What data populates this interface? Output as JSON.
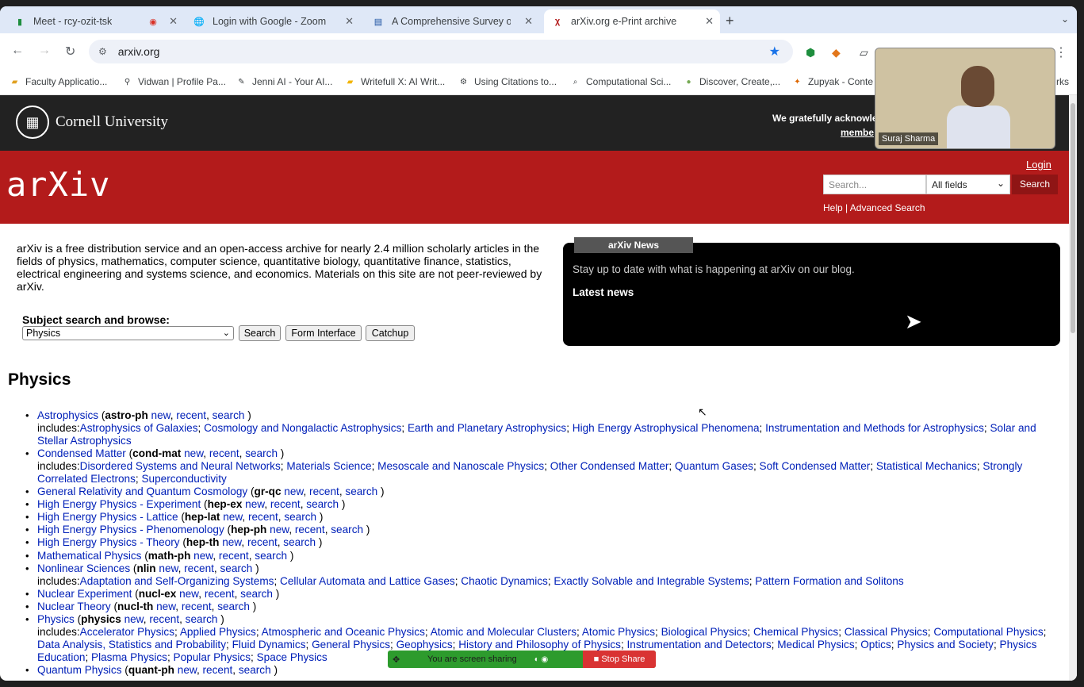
{
  "browser": {
    "tabs": [
      {
        "title": "Meet - rcy-ozit-tsk",
        "icon": "meet-icon"
      },
      {
        "title": "",
        "icon": "recording-icon"
      },
      {
        "title": "Login with Google - Zoom",
        "icon": "globe-icon"
      },
      {
        "title": "A Comprehensive Survey on",
        "icon": "doc-icon"
      },
      {
        "title": "arXiv.org e-Print archive",
        "icon": "arxiv-icon"
      }
    ],
    "url": "arxiv.org",
    "bookmarks": [
      "Faculty Applicatio...",
      "Vidwan | Profile Pa...",
      "Jenni AI - Your AI...",
      "Writefull X: AI Writ...",
      "Using Citations to...",
      "Computational Sci...",
      "Discover, Create,...",
      "Zupyak - Conte",
      "rks"
    ]
  },
  "cornell": {
    "name": "Cornell University",
    "acknowledge": "We gratefully acknowle",
    "members": "membe"
  },
  "arxiv": {
    "logo": "arXiv",
    "login": "Login",
    "search_placeholder": "Search...",
    "field": "All fields",
    "search_button": "Search",
    "help": "Help | Advanced Search"
  },
  "intro": "arXiv is a free distribution service and an open-access archive for nearly 2.4 million scholarly articles in the fields of physics, mathematics, computer science, quantitative biology, quantitative finance, statistics, electrical engineering and systems science, and economics. Materials on this site are not peer-reviewed by arXiv.",
  "subject": {
    "label": "Subject search and browse:",
    "selected": "Physics",
    "buttons": [
      "Search",
      "Form Interface",
      "Catchup"
    ]
  },
  "news": {
    "tab": "arXiv News",
    "text": "Stay up to date with what is happening at arXiv on our blog.",
    "latest": "Latest news"
  },
  "section_title": "Physics",
  "entries": [
    {
      "name": "Astrophysics",
      "code": "astro-ph",
      "includes": [
        "Astrophysics of Galaxies",
        "Cosmology and Nongalactic Astrophysics",
        "Earth and Planetary Astrophysics",
        "High Energy Astrophysical Phenomena",
        "Instrumentation and Methods for Astrophysics",
        "Solar and Stellar Astrophysics"
      ]
    },
    {
      "name": "Condensed Matter",
      "code": "cond-mat",
      "includes": [
        "Disordered Systems and Neural Networks",
        "Materials Science",
        "Mesoscale and Nanoscale Physics",
        "Other Condensed Matter",
        "Quantum Gases",
        "Soft Condensed Matter",
        "Statistical Mechanics",
        "Strongly Correlated Electrons",
        "Superconductivity"
      ]
    },
    {
      "name": "General Relativity and Quantum Cosmology",
      "code": "gr-qc",
      "includes": []
    },
    {
      "name": "High Energy Physics - Experiment",
      "code": "hep-ex",
      "includes": []
    },
    {
      "name": "High Energy Physics - Lattice",
      "code": "hep-lat",
      "includes": []
    },
    {
      "name": "High Energy Physics - Phenomenology",
      "code": "hep-ph",
      "includes": []
    },
    {
      "name": "High Energy Physics - Theory",
      "code": "hep-th",
      "includes": []
    },
    {
      "name": "Mathematical Physics",
      "code": "math-ph",
      "includes": []
    },
    {
      "name": "Nonlinear Sciences",
      "code": "nlin",
      "includes": [
        "Adaptation and Self-Organizing Systems",
        "Cellular Automata and Lattice Gases",
        "Chaotic Dynamics",
        "Exactly Solvable and Integrable Systems",
        "Pattern Formation and Solitons"
      ]
    },
    {
      "name": "Nuclear Experiment",
      "code": "nucl-ex",
      "includes": []
    },
    {
      "name": "Nuclear Theory",
      "code": "nucl-th",
      "includes": []
    },
    {
      "name": "Physics",
      "code": "physics",
      "includes": [
        "Accelerator Physics",
        "Applied Physics",
        "Atmospheric and Oceanic Physics",
        "Atomic and Molecular Clusters",
        "Atomic Physics",
        "Biological Physics",
        "Chemical Physics",
        "Classical Physics",
        "Computational Physics",
        "Data Analysis, Statistics and Probability",
        "Fluid Dynamics",
        "General Physics",
        "Geophysics",
        "History and Philosophy of Physics",
        "Instrumentation and Detectors",
        "Medical Physics",
        "Optics",
        "Physics and Society",
        "Physics Education",
        "Plasma Physics",
        "Popular Physics",
        "Space Physics"
      ]
    },
    {
      "name": "Quantum Physics",
      "code": "quant-ph",
      "includes": []
    }
  ],
  "entry_links": [
    "new",
    "recent",
    "search"
  ],
  "includes_label": "includes:",
  "video": {
    "name": "Suraj Sharma"
  },
  "share": {
    "text": "You are screen sharing",
    "stop": "Stop Share"
  }
}
